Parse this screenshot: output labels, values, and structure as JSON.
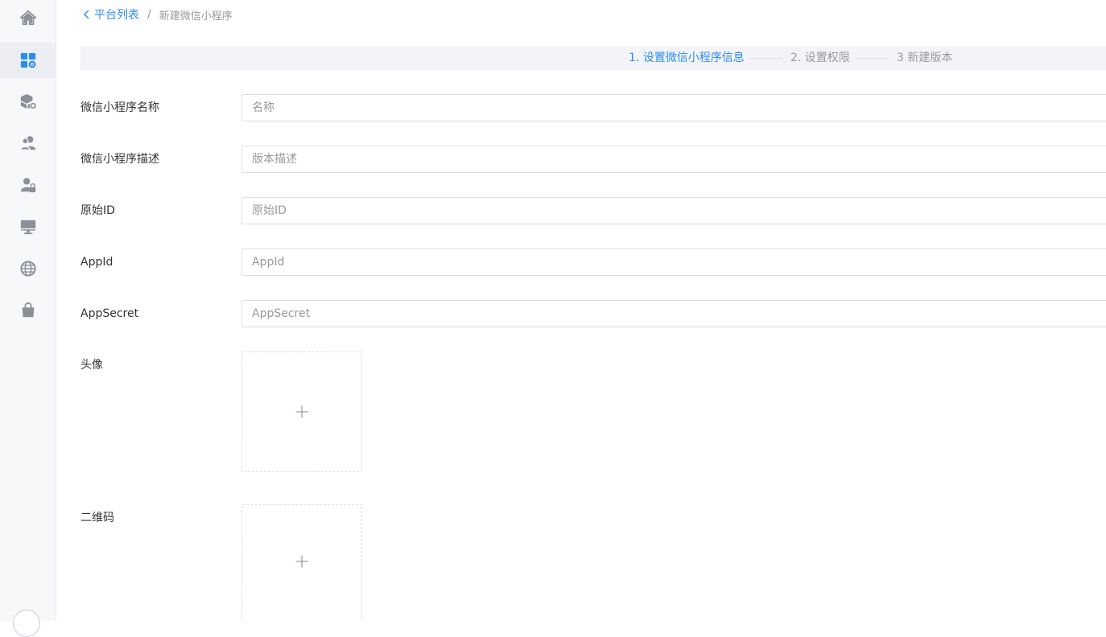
{
  "breadcrumb": {
    "back_label": "平台列表",
    "separator": "/",
    "current": "新建微信小程序"
  },
  "steps": [
    {
      "label": "1. 设置微信小程序信息",
      "active": true
    },
    {
      "label": "2. 设置权限",
      "active": false
    },
    {
      "label": "3 新建版本",
      "active": false
    }
  ],
  "form": {
    "name": {
      "label": "微信小程序名称",
      "placeholder": "名称",
      "value": ""
    },
    "description": {
      "label": "微信小程序描述",
      "placeholder": "版本描述",
      "value": ""
    },
    "original_id": {
      "label": "原始ID",
      "placeholder": "原始ID",
      "value": ""
    },
    "app_id": {
      "label": "AppId",
      "placeholder": "AppId",
      "value": ""
    },
    "app_secret": {
      "label": "AppSecret",
      "placeholder": "AppSecret",
      "value": ""
    },
    "avatar": {
      "label": "头像"
    },
    "qrcode": {
      "label": "二维码"
    }
  },
  "sidebar": {
    "items": [
      {
        "icon": "home-icon"
      },
      {
        "icon": "apps-settings-icon",
        "active": true
      },
      {
        "icon": "package-settings-icon"
      },
      {
        "icon": "users-icon"
      },
      {
        "icon": "user-lock-icon"
      },
      {
        "icon": "monitor-icon"
      },
      {
        "icon": "globe-icon"
      },
      {
        "icon": "shopping-bag-icon"
      }
    ]
  },
  "colors": {
    "accent": "#2d8cf0",
    "icon_gray": "#8a8f99",
    "sidebar_bg": "#f7f8fa",
    "steps_bg": "#f3f4f8",
    "border": "#dcdee2"
  }
}
